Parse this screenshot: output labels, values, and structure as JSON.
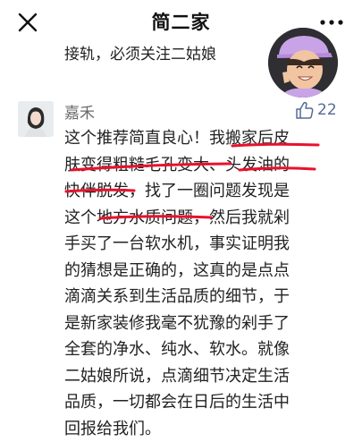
{
  "header": {
    "title": "简二家",
    "close_icon": "close-icon",
    "more_icon": "more-horizontal-icon"
  },
  "previous_comment": {
    "tail_text": "接轨，必须关注二姑娘"
  },
  "comment": {
    "author": "嘉禾",
    "likes": "22",
    "lines": [
      "这个推荐简直良心！我搬家后皮",
      "肤变得粗糙毛孔变大、头发油的",
      "快伴脱发，找了一圈问题发现是",
      "这个地方水质问题，然后我就剁",
      "手买了一台软水机，事实证明我",
      "的猜想是正确的，这真的是点点",
      "滴滴关系到生活品质的细节，于",
      "是新家装修我毫不犹豫的剁手了",
      "全套的净水、纯水、软水。就像",
      "二姑娘所说，点滴细节决定生活",
      "品质，一切都会在日后的生活中",
      "回报给我们。"
    ]
  },
  "colors": {
    "underline": "#e8122c",
    "like_accent": "#576b95",
    "name_gray": "#6b6b6b"
  }
}
